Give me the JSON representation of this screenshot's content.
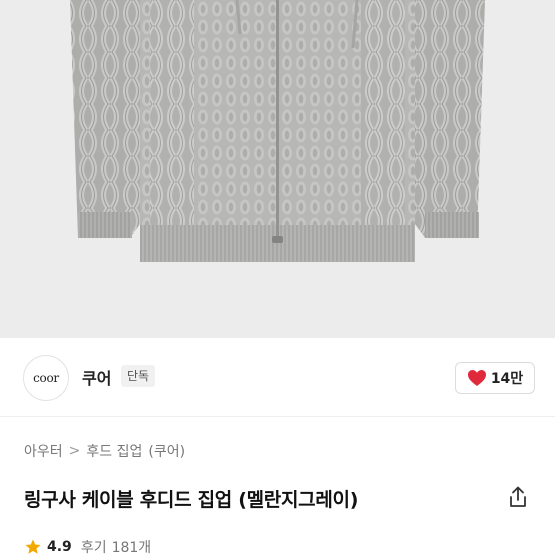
{
  "product_image": {
    "alt": "링구사 케이블 후디드 집업 (멜란지그레이)",
    "icon": "sweater-image"
  },
  "brand": {
    "logo_text": "coor",
    "name": "쿠어",
    "badge": "단독"
  },
  "like": {
    "count_label": "14만",
    "icon": "heart-icon",
    "color": "#e0293b"
  },
  "breadcrumb": [
    "아우터",
    "후드 집업",
    "(쿠어)"
  ],
  "breadcrumb_separator": ">",
  "product": {
    "title": "링구사 케이블 후디드 집업 (멜란지그레이)"
  },
  "rating": {
    "value": "4.9",
    "review_label": "후기",
    "review_count": "181개",
    "star_color": "#f2a900"
  },
  "share": {
    "icon": "share-icon"
  }
}
